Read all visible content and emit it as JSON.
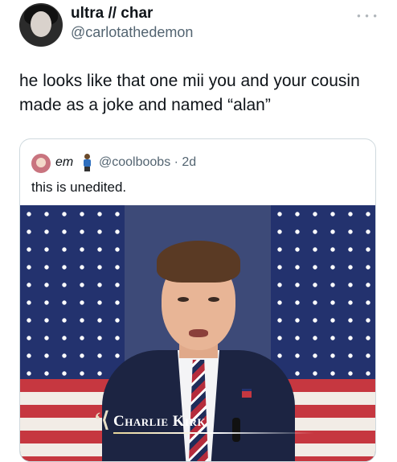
{
  "post": {
    "display_name": "ultra // char",
    "handle": "@carlotathedemon",
    "more_icon": "more-icon",
    "text": "he looks like that one mii you and your cousin made as a joke and named “alan”"
  },
  "quote": {
    "name": "em",
    "handle": "@coolboobs · 2d",
    "text": "this is unedited.",
    "media": {
      "lower_third": "Charlie Kirk"
    }
  }
}
